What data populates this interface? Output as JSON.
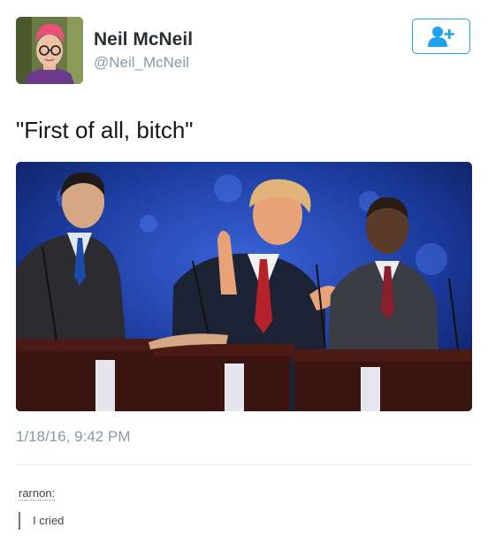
{
  "tweet": {
    "display_name": "Neil McNeil",
    "handle": "@Neil_McNeil",
    "text": "\"First of all, bitch\"",
    "timestamp": "1/18/16, 9:42 PM",
    "follow_icon": "add-user-icon"
  },
  "reblog": {
    "username": "rarnon:",
    "comment": "I cried"
  },
  "colors": {
    "accent": "#1da1f2",
    "muted_text": "#8899a6",
    "stage_background": "#1b3a9c"
  }
}
